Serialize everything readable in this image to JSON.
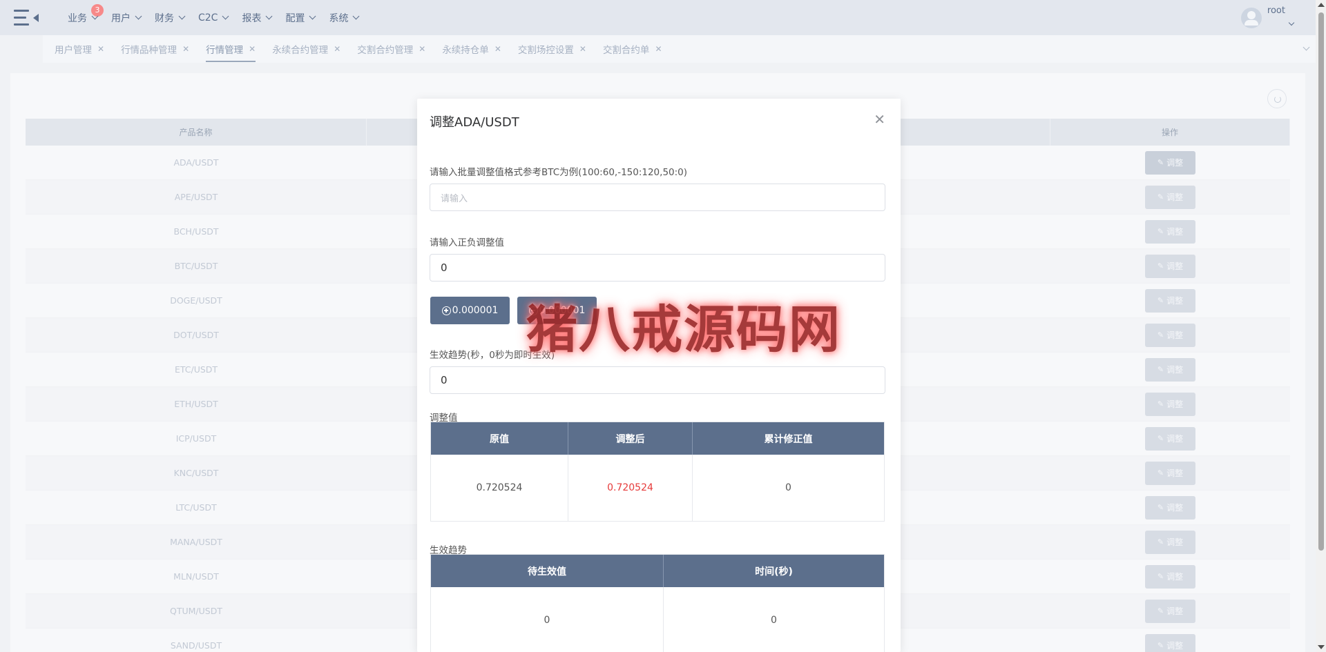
{
  "nav": {
    "items": [
      {
        "label": "业务",
        "badge": "3"
      },
      {
        "label": "用户"
      },
      {
        "label": "财务"
      },
      {
        "label": "C2C"
      },
      {
        "label": "报表"
      },
      {
        "label": "配置"
      },
      {
        "label": "系统"
      }
    ],
    "user": "root"
  },
  "tabs": [
    {
      "label": "用户管理"
    },
    {
      "label": "行情品种管理"
    },
    {
      "label": "行情管理",
      "active": true
    },
    {
      "label": "永续合约管理"
    },
    {
      "label": "交割合约管理"
    },
    {
      "label": "永续持仓单"
    },
    {
      "label": "交割场控设置"
    },
    {
      "label": "交割合约单"
    }
  ],
  "table": {
    "headers": {
      "name": "产品名称",
      "op": "操作"
    },
    "op_label": "调整",
    "rows": [
      "ADA/USDT",
      "APE/USDT",
      "BCH/USDT",
      "BTC/USDT",
      "DOGE/USDT",
      "DOT/USDT",
      "ETC/USDT",
      "ETH/USDT",
      "ICP/USDT",
      "KNC/USDT",
      "LTC/USDT",
      "MANA/USDT",
      "MLN/USDT",
      "QTUM/USDT",
      "SAND/USDT"
    ]
  },
  "modal": {
    "title": "调整ADA/USDT",
    "batch_label": "请输入批量调整值格式参考BTC为例(100:60,-150:120,50:0)",
    "batch_placeholder": "请输入",
    "adjust_label": "请输入正负调整值",
    "adjust_value": "0",
    "plus_button": "0.000001",
    "minus_button": "0.000001",
    "trend_label": "生效趋势(秒，0秒为即时生效)",
    "trend_value": "0",
    "adjust_section": "调整值",
    "adjust_table": {
      "headers": [
        "原值",
        "调整后",
        "累计修正值"
      ],
      "row": [
        "0.720524",
        "0.720524",
        "0"
      ]
    },
    "trend_section": "生效趋势",
    "trend_table": {
      "headers": [
        "待生效值",
        "时间(秒)"
      ],
      "row": [
        "0",
        "0"
      ]
    }
  },
  "watermark": "猪八戒源码网",
  "colors": {
    "primary": "#5c6f8c",
    "highlight": "#e63a3a",
    "nav_bg": "#e3e7ee"
  }
}
